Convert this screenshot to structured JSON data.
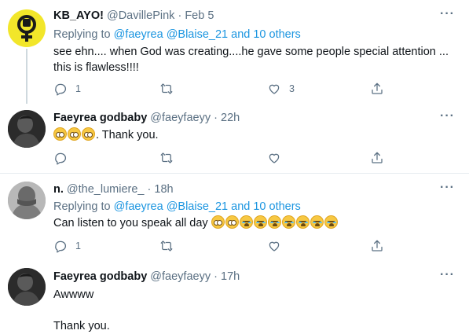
{
  "tweets": [
    {
      "name": "KB_AYO!",
      "handle": "@DavillePink",
      "dot": "·",
      "time": "Feb 5",
      "replying_prefix": "Replying to",
      "replying_mentions": "@faeyrea @Blaise_21 and 10 others",
      "text_line1": "see ehn.... when God was creating....he gave some people special attention ...",
      "text_line2": "this is flawless!!!!",
      "reply_count": "1",
      "like_count": "3"
    },
    {
      "name": "Faeyrea godbaby",
      "handle": "@faeyfaeyy",
      "dot": "·",
      "time": "22h",
      "text_after_emoji": ". Thank you."
    },
    {
      "name": "n.",
      "handle": "@the_lumiere_",
      "dot": "·",
      "time": "18h",
      "replying_prefix": "Replying to",
      "replying_mentions": "@faeyrea @Blaise_21 and 10 others",
      "text": "Can listen to you speak all day",
      "reply_count": "1"
    },
    {
      "name": "Faeyrea godbaby",
      "handle": "@faeyfaeyy",
      "dot": "·",
      "time": "17h",
      "text_line1": "Awwww",
      "text_line2": "Thank you."
    }
  ],
  "more_label": "···",
  "icons": [
    "reply-icon",
    "retweet-icon",
    "like-icon",
    "share-icon",
    "more-icon",
    "pleading-face-emoji",
    "loudly-crying-emoji",
    "feminist-symbol-avatar"
  ],
  "colors": {
    "link": "#1b95e0",
    "secondary": "#5b7083",
    "divider": "#e6ecf0",
    "avatar1_bg": "#f2e62a"
  }
}
